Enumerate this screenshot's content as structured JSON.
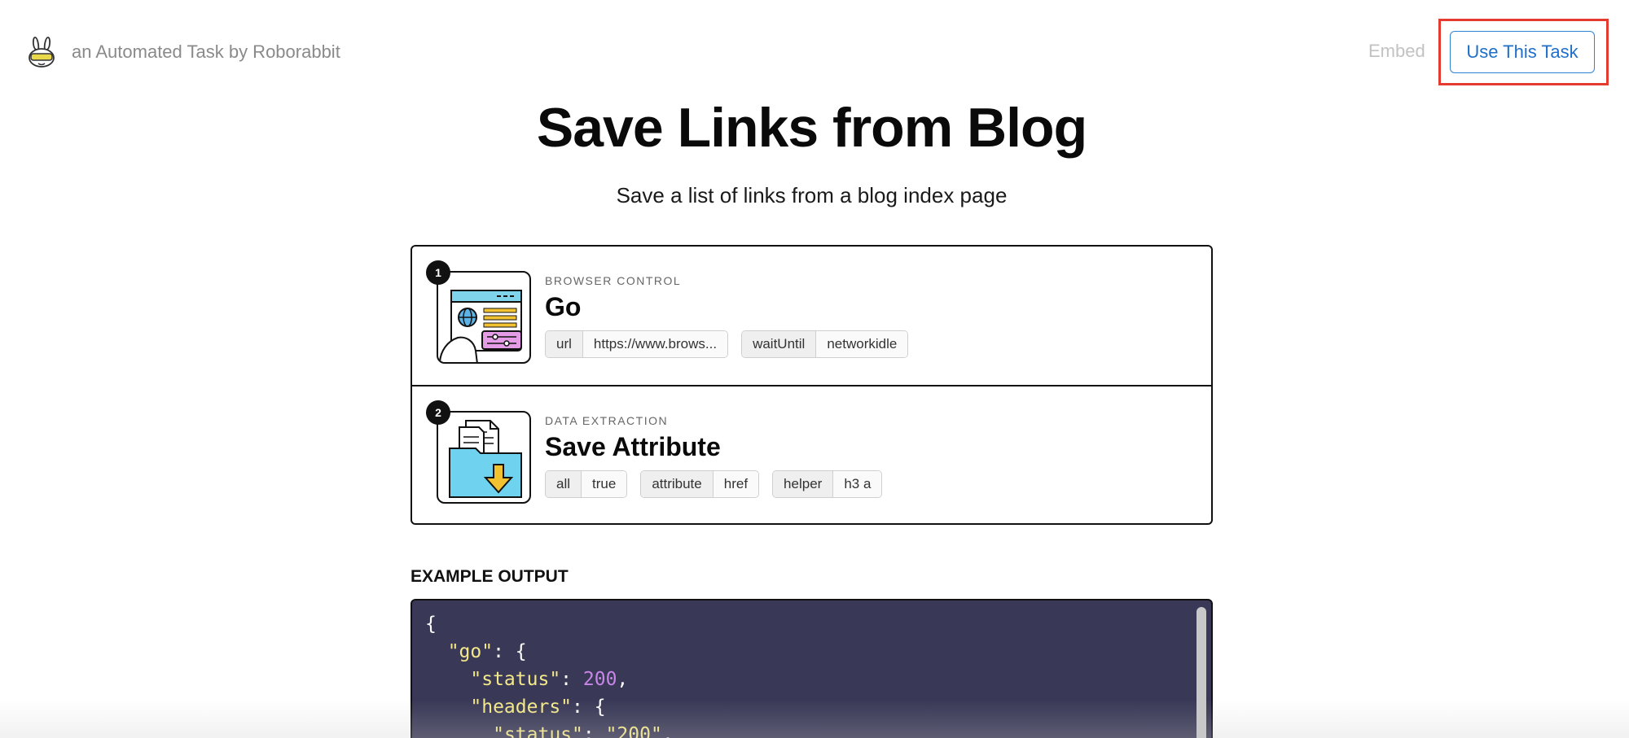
{
  "header": {
    "brand_text": "an Automated Task by Roborabbit",
    "embed_label": "Embed",
    "use_button_label": "Use This Task"
  },
  "title": "Save Links from Blog",
  "subtitle": "Save a list of links from a blog index page",
  "steps": [
    {
      "number": "1",
      "category": "BROWSER CONTROL",
      "name": "Go",
      "icon": "browser-window-icon",
      "params": [
        {
          "key": "url",
          "value": "https://www.brows..."
        },
        {
          "key": "waitUntil",
          "value": "networkidle"
        }
      ]
    },
    {
      "number": "2",
      "category": "DATA EXTRACTION",
      "name": "Save Attribute",
      "icon": "folder-download-icon",
      "params": [
        {
          "key": "all",
          "value": "true"
        },
        {
          "key": "attribute",
          "value": "href"
        },
        {
          "key": "helper",
          "value": "h3 a"
        }
      ]
    }
  ],
  "output": {
    "label": "EXAMPLE OUTPUT",
    "lines": [
      {
        "indent": "",
        "key": "",
        "punct": "{",
        "value": ""
      },
      {
        "indent": "  ",
        "key": "\"go\"",
        "punct": ": {",
        "value": ""
      },
      {
        "indent": "    ",
        "key": "\"status\"",
        "punct": ": ",
        "value": "200",
        "tail": ","
      },
      {
        "indent": "    ",
        "key": "\"headers\"",
        "punct": ": {",
        "value": ""
      },
      {
        "indent": "      ",
        "key": "\"status\"",
        "punct": ": ",
        "value": "\"200\"",
        "tail": ","
      }
    ]
  },
  "colors": {
    "accent": "#1d6fc9",
    "highlight": "#e53a2f",
    "code_bg": "#393856"
  }
}
